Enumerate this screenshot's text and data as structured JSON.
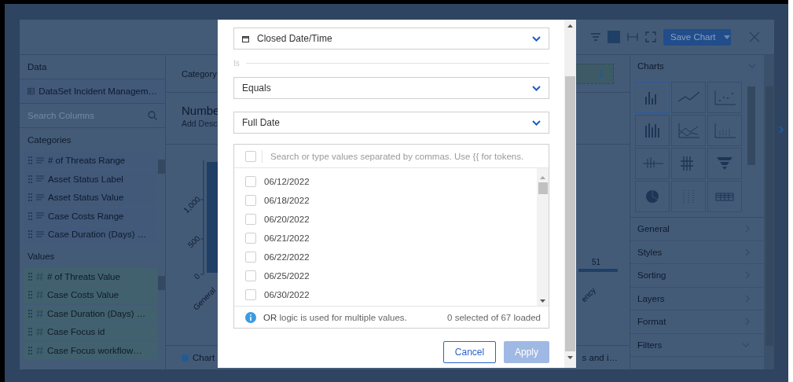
{
  "toolbar": {
    "save_button": "Save Chart"
  },
  "data_panel": {
    "title": "Data",
    "dataset": "DataSet Incident Managem…",
    "search": {
      "placeholder": "Search Columns"
    },
    "categories": {
      "title": "Categories",
      "items": [
        "# of Threats Range",
        "Asset Status Label",
        "Asset Status Value",
        "Case Costs Range",
        "Case Duration (Days) …"
      ]
    },
    "values": {
      "title": "Values",
      "items": [
        "# of Threats Value",
        "Case Costs Value",
        "Case Duration (Days) …",
        "Case Focus id",
        "Case Focus workflow…"
      ]
    }
  },
  "chart_area": {
    "category_label": "Category",
    "title": "Numbe",
    "description": "Add Desc",
    "y_labels": [
      "1,000",
      "500",
      "0"
    ],
    "x_labels": [
      "General",
      "ency"
    ],
    "data_label": "51",
    "legend": [
      "Chart",
      "s and i…"
    ]
  },
  "settings_panel": {
    "charts_title": "Charts",
    "charts_expanded": true,
    "chart_types": [
      {
        "kind": "column",
        "selected": true
      },
      {
        "kind": "line",
        "selected": false
      },
      {
        "kind": "scatter",
        "selected": false
      },
      {
        "kind": "stacked",
        "selected": false
      },
      {
        "kind": "area",
        "selected": false
      },
      {
        "kind": "step",
        "selected": false
      },
      {
        "kind": "hilo",
        "selected": false
      },
      {
        "kind": "candle",
        "selected": false
      },
      {
        "kind": "funnel",
        "selected": false
      },
      {
        "kind": "pie",
        "selected": false
      },
      {
        "kind": "dots",
        "selected": false
      },
      {
        "kind": "grid",
        "selected": false
      }
    ],
    "sections": [
      {
        "label": "General",
        "expanded": false
      },
      {
        "label": "Styles",
        "expanded": false
      },
      {
        "label": "Sorting",
        "expanded": false
      },
      {
        "label": "Layers",
        "expanded": false
      },
      {
        "label": "Format",
        "expanded": false
      },
      {
        "label": "Filters",
        "expanded": true
      }
    ]
  },
  "dialog": {
    "field": "Closed Date/Time",
    "operator_label": "Is",
    "operator": "Equals",
    "granularity": "Full Date",
    "search": {
      "placeholder": "Search or type values separated by commas. Use {{ for tokens.",
      "checked": false
    },
    "options": [
      {
        "label": "06/12/2022",
        "checked": false
      },
      {
        "label": "06/18/2022",
        "checked": false
      },
      {
        "label": "06/20/2022",
        "checked": false
      },
      {
        "label": "06/21/2022",
        "checked": false
      },
      {
        "label": "06/22/2022",
        "checked": false
      },
      {
        "label": "06/25/2022",
        "checked": false
      },
      {
        "label": "06/30/2022",
        "checked": false
      }
    ],
    "note": "**OR** logic is used for multiple values.",
    "count": "0 selected of 67 loaded",
    "buttons": [
      {
        "label": "Cancel",
        "kind": "secondary",
        "disabled": false
      },
      {
        "label": "Apply",
        "kind": "primary",
        "disabled": true
      }
    ]
  }
}
